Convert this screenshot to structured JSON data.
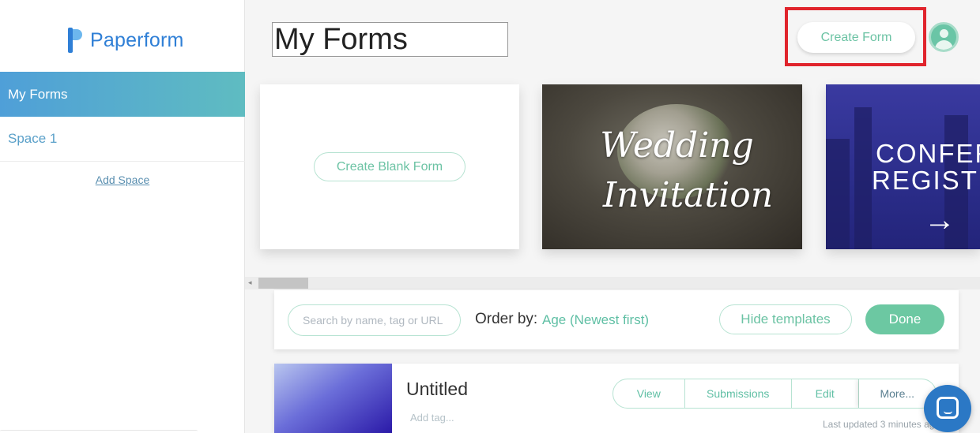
{
  "sidebar": {
    "logo_text": "Paperform",
    "items": [
      {
        "label": "My Forms",
        "active": true
      },
      {
        "label": "Space 1",
        "active": false
      }
    ],
    "add_space": "Add Space"
  },
  "header": {
    "title": "My Forms",
    "create_form": "Create Form",
    "avatar_icon": "user-icon"
  },
  "templates": {
    "blank_button": "Create Blank Form",
    "wedding": {
      "line1": "Wedding",
      "line2": "Invitation"
    },
    "conference": {
      "line1": "CONFERE",
      "line2": "REGISTRA",
      "arrow": "→"
    }
  },
  "filter": {
    "search_placeholder": "Search by name, tag or URL",
    "order_label": "Order by:",
    "order_value": "Age (Newest first)",
    "hide_templates": "Hide templates",
    "done": "Done"
  },
  "forms": [
    {
      "title": "Untitled",
      "add_tag": "Add tag...",
      "actions": {
        "view": "View",
        "submissions": "Submissions",
        "edit": "Edit",
        "more": "More..."
      },
      "updated": "Last updated 3 minutes ago"
    }
  ],
  "colors": {
    "accent": "#6cc3a4",
    "brand": "#2f7fd6",
    "highlight": "#e0242c",
    "chat": "#2b78c5"
  }
}
